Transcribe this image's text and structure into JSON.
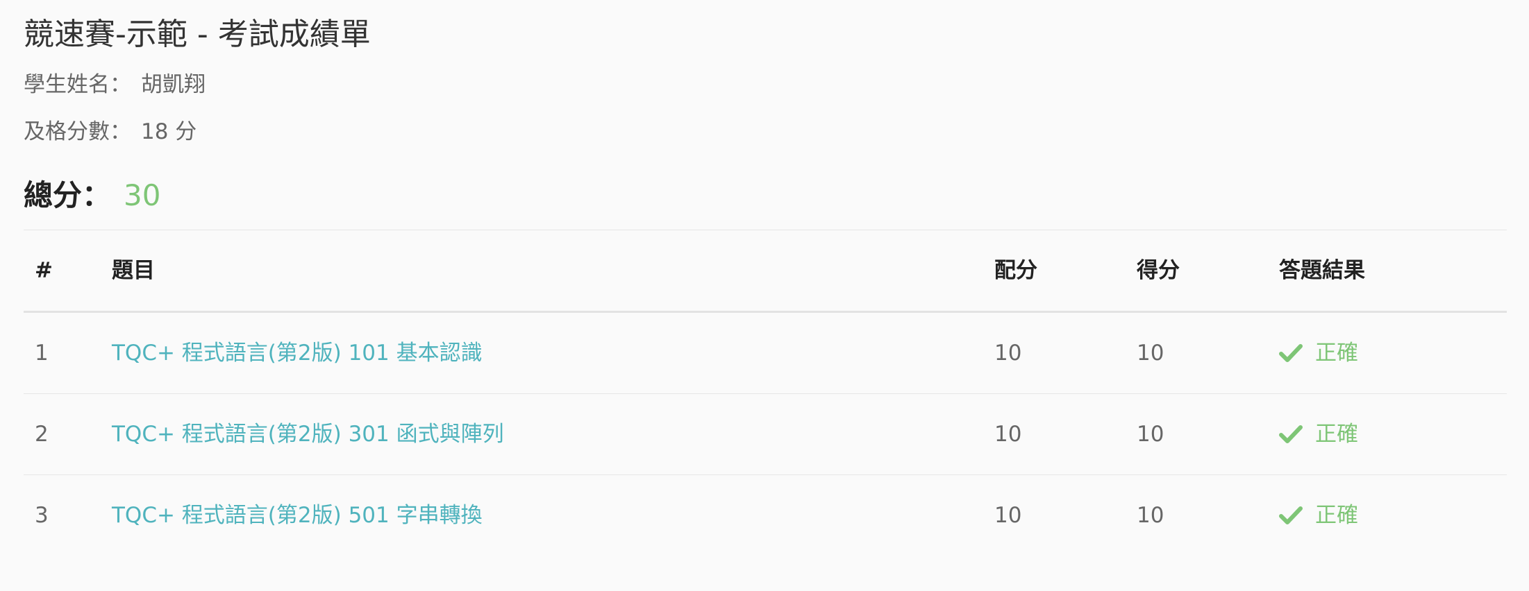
{
  "exam": {
    "title": "競速賽-示範 - 考試成績單",
    "student_label": "學生姓名：",
    "student_name": "胡凱翔",
    "pass_label": "及格分數：",
    "pass_score": "18 分",
    "total_label": "總分：",
    "total_score": "30"
  },
  "table": {
    "headers": {
      "num": "#",
      "title": "題目",
      "max_score": "配分",
      "score": "得分",
      "result": "答題結果"
    },
    "rows": [
      {
        "num": "1",
        "title": "TQC+ 程式語言(第2版) 101 基本認識",
        "max_score": "10",
        "score": "10",
        "result": "正確",
        "result_icon": "check-icon"
      },
      {
        "num": "2",
        "title": "TQC+ 程式語言(第2版) 301 函式與陣列",
        "max_score": "10",
        "score": "10",
        "result": "正確",
        "result_icon": "check-icon"
      },
      {
        "num": "3",
        "title": "TQC+ 程式語言(第2版) 501 字串轉換",
        "max_score": "10",
        "score": "10",
        "result": "正確",
        "result_icon": "check-icon"
      }
    ]
  },
  "colors": {
    "link": "#4fb3bd",
    "success": "#7ec576",
    "background": "#fafafa"
  }
}
